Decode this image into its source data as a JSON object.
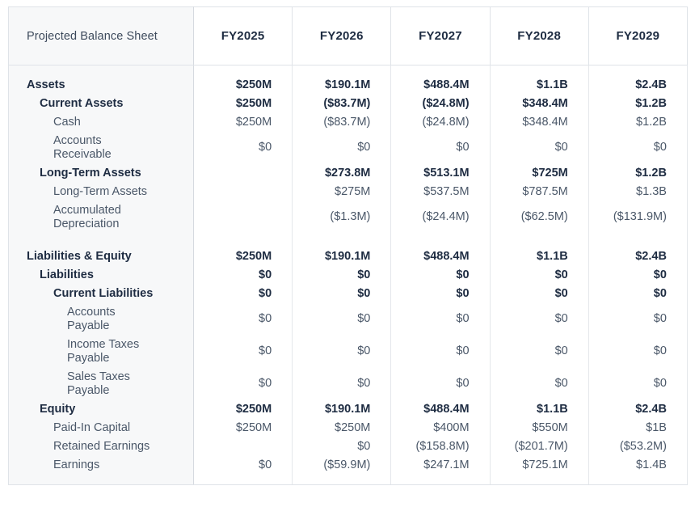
{
  "table": {
    "title": "Projected Balance Sheet",
    "columns": [
      "FY2025",
      "FY2026",
      "FY2027",
      "FY2028",
      "FY2029"
    ],
    "colors": {
      "label_column_bg": "#f7f8f9",
      "value_column_bg": "#ffffff",
      "border": "#dfe3e8",
      "bold_text": "#1e2c42",
      "regular_text": "#4a5768"
    },
    "rows": [
      {
        "label": "Assets",
        "indent": 0,
        "bold": true,
        "wrap": false,
        "values": [
          "$250M",
          "$190.1M",
          "$488.4M",
          "$1.1B",
          "$2.4B"
        ]
      },
      {
        "label": "Current Assets",
        "indent": 1,
        "bold": true,
        "wrap": false,
        "values": [
          "$250M",
          "($83.7M)",
          "($24.8M)",
          "$348.4M",
          "$1.2B"
        ]
      },
      {
        "label": "Cash",
        "indent": 2,
        "bold": false,
        "wrap": false,
        "values": [
          "$250M",
          "($83.7M)",
          "($24.8M)",
          "$348.4M",
          "$1.2B"
        ]
      },
      {
        "label": "Accounts Receivable",
        "indent": 2,
        "bold": false,
        "wrap": true,
        "values": [
          "$0",
          "$0",
          "$0",
          "$0",
          "$0"
        ]
      },
      {
        "label": "Long-Term Assets",
        "indent": 1,
        "bold": true,
        "wrap": false,
        "values": [
          "",
          "$273.8M",
          "$513.1M",
          "$725M",
          "$1.2B"
        ]
      },
      {
        "label": "Long-Term Assets",
        "indent": 2,
        "bold": false,
        "wrap": false,
        "values": [
          "",
          "$275M",
          "$537.5M",
          "$787.5M",
          "$1.3B"
        ]
      },
      {
        "label": "Accumulated Depreciation",
        "indent": 2,
        "bold": false,
        "wrap": true,
        "values": [
          "",
          "($1.3M)",
          "($24.4M)",
          "($62.5M)",
          "($131.9M)"
        ]
      },
      {
        "label": "Liabilities & Equity",
        "indent": 0,
        "bold": true,
        "wrap": false,
        "section_break": true,
        "values": [
          "$250M",
          "$190.1M",
          "$488.4M",
          "$1.1B",
          "$2.4B"
        ]
      },
      {
        "label": "Liabilities",
        "indent": 1,
        "bold": true,
        "wrap": false,
        "values": [
          "$0",
          "$0",
          "$0",
          "$0",
          "$0"
        ]
      },
      {
        "label": "Current Liabilities",
        "indent": 2,
        "bold": true,
        "wrap": false,
        "values": [
          "$0",
          "$0",
          "$0",
          "$0",
          "$0"
        ]
      },
      {
        "label": "Accounts Payable",
        "indent": 3,
        "bold": false,
        "wrap": true,
        "values": [
          "$0",
          "$0",
          "$0",
          "$0",
          "$0"
        ]
      },
      {
        "label": "Income Taxes Payable",
        "indent": 3,
        "bold": false,
        "wrap": true,
        "values": [
          "$0",
          "$0",
          "$0",
          "$0",
          "$0"
        ]
      },
      {
        "label": "Sales Taxes Payable",
        "indent": 3,
        "bold": false,
        "wrap": true,
        "values": [
          "$0",
          "$0",
          "$0",
          "$0",
          "$0"
        ]
      },
      {
        "label": "Equity",
        "indent": 1,
        "bold": true,
        "wrap": false,
        "values": [
          "$250M",
          "$190.1M",
          "$488.4M",
          "$1.1B",
          "$2.4B"
        ]
      },
      {
        "label": "Paid-In Capital",
        "indent": 2,
        "bold": false,
        "wrap": false,
        "values": [
          "$250M",
          "$250M",
          "$400M",
          "$550M",
          "$1B"
        ]
      },
      {
        "label": "Retained Earnings",
        "indent": 2,
        "bold": false,
        "wrap": false,
        "values": [
          "",
          "$0",
          "($158.8M)",
          "($201.7M)",
          "($53.2M)"
        ]
      },
      {
        "label": "Earnings",
        "indent": 2,
        "bold": false,
        "wrap": false,
        "values": [
          "$0",
          "($59.9M)",
          "$247.1M",
          "$725.1M",
          "$1.4B"
        ]
      }
    ]
  }
}
